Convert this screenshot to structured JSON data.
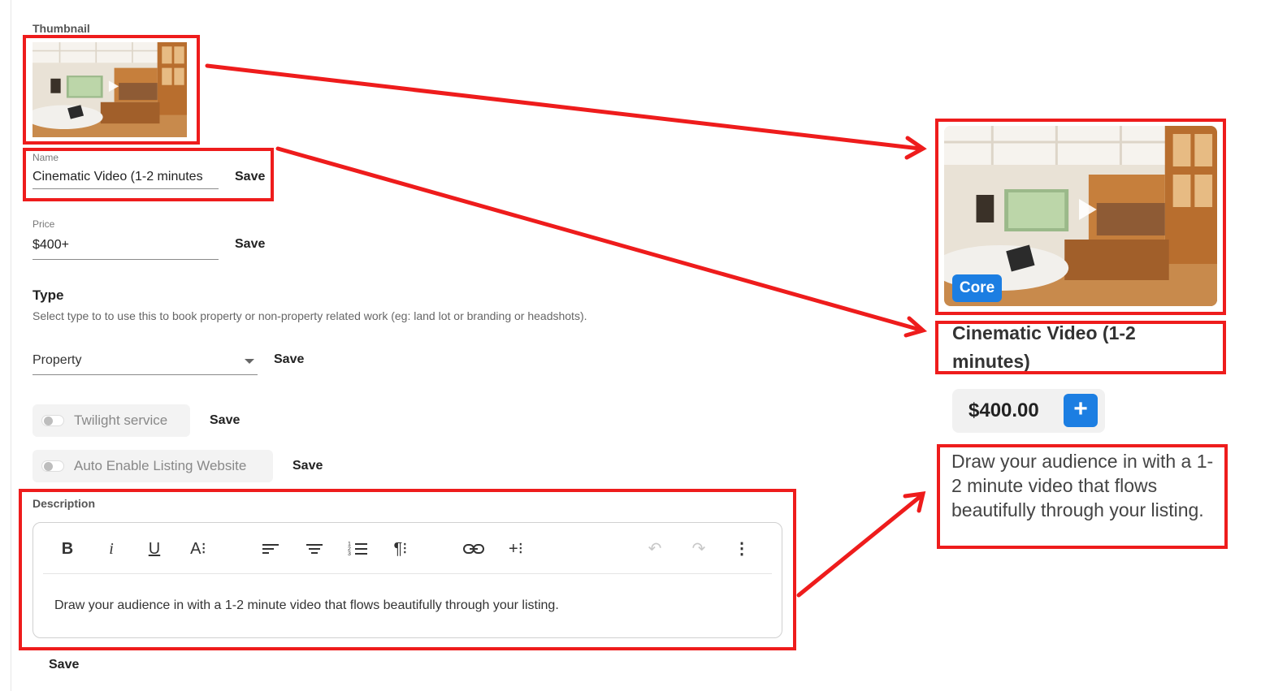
{
  "form": {
    "thumbnail_label": "Thumbnail",
    "name": {
      "label": "Name",
      "value": "Cinematic Video (1-2 minutes",
      "save_label": "Save"
    },
    "price": {
      "label": "Price",
      "value": "$400+",
      "save_label": "Save"
    },
    "type": {
      "title": "Type",
      "help": "Select type to to use this to book property or non-property related work (eg: land lot or branding or headshots).",
      "selected": "Property",
      "save_label": "Save"
    },
    "toggles": [
      {
        "label": "Twilight service",
        "save_label": "Save",
        "enabled": false
      },
      {
        "label": "Auto Enable Listing Website",
        "save_label": "Save",
        "enabled": false
      }
    ],
    "description": {
      "label": "Description",
      "text": "Draw your audience in with a 1-2 minute video that flows beautifully through your listing.",
      "save_label": "Save",
      "toolbar": [
        "bold-icon",
        "italic-icon",
        "underline-icon",
        "font-size-icon",
        "align-left-icon",
        "align-center-icon",
        "numbered-list-icon",
        "paragraph-icon",
        "link-icon",
        "insert-icon",
        "undo-icon",
        "redo-icon",
        "more-vertical-icon"
      ]
    }
  },
  "preview": {
    "badge": "Core",
    "title": "Cinematic Video (1-2 minutes)",
    "price": "$400.00",
    "add_label": "+",
    "description": "Draw your audience in with a 1-2 minute video that flows beautifully through your listing."
  },
  "annotation": {
    "color": "#ee1c1c"
  },
  "colors": {
    "accent": "#1c7ee2"
  }
}
